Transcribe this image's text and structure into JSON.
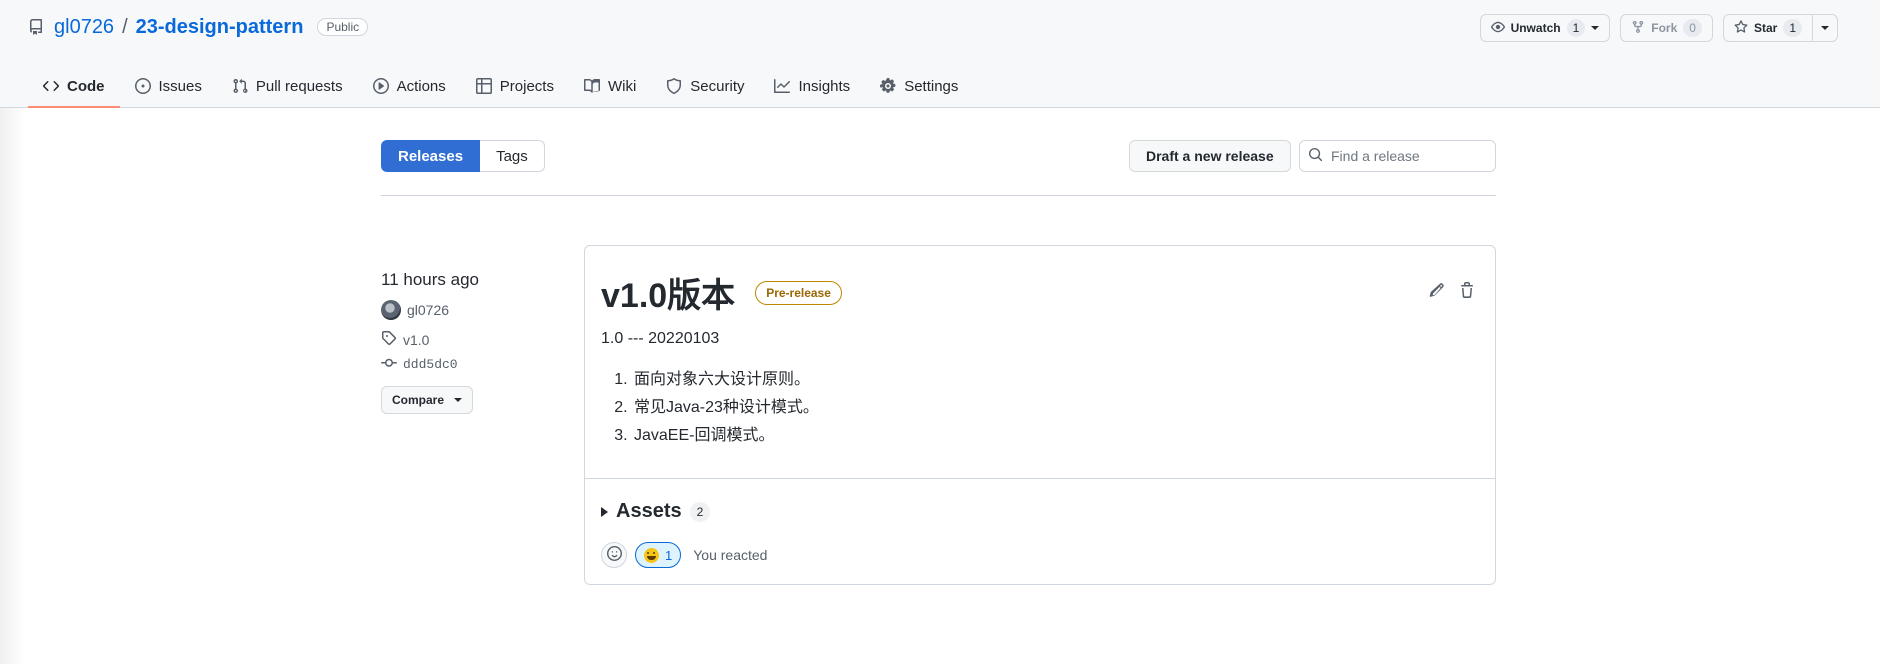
{
  "repo": {
    "owner": "gl0726",
    "separator": "/",
    "name": "23-design-pattern",
    "visibility": "Public"
  },
  "actions": {
    "watch_label": "Unwatch",
    "watch_count": "1",
    "fork_label": "Fork",
    "fork_count": "0",
    "star_label": "Star",
    "star_count": "1"
  },
  "nav": {
    "items": [
      {
        "label": "Code",
        "icon": "code-icon"
      },
      {
        "label": "Issues",
        "icon": "issue-icon"
      },
      {
        "label": "Pull requests",
        "icon": "pull-request-icon"
      },
      {
        "label": "Actions",
        "icon": "play-icon"
      },
      {
        "label": "Projects",
        "icon": "table-icon"
      },
      {
        "label": "Wiki",
        "icon": "book-icon"
      },
      {
        "label": "Security",
        "icon": "shield-icon"
      },
      {
        "label": "Insights",
        "icon": "graph-icon"
      },
      {
        "label": "Settings",
        "icon": "gear-icon"
      }
    ],
    "selected": "Code",
    "accent": "#fd8c73"
  },
  "subnav": {
    "releases_label": "Releases",
    "tags_label": "Tags",
    "draft_label": "Draft a new release",
    "search_placeholder": "Find a release"
  },
  "release": {
    "time": "11 hours ago",
    "author": "gl0726",
    "tag": "v1.0",
    "commit": "ddd5dc0",
    "compare_label": "Compare",
    "title": "v1.0版本",
    "badge": "Pre-release",
    "subtitle": "1.0 --- 20220103",
    "notes": [
      "面向对象六大设计原则。",
      "常见Java-23种设计模式。",
      "JavaEE-回调模式。"
    ],
    "assets_label": "Assets",
    "assets_count": "2",
    "reaction_count": "1",
    "reaction_text": "You reacted"
  },
  "colors": {
    "link": "#0969da",
    "primary_tab": "#316ed4",
    "prerelease": "#9a6700"
  }
}
